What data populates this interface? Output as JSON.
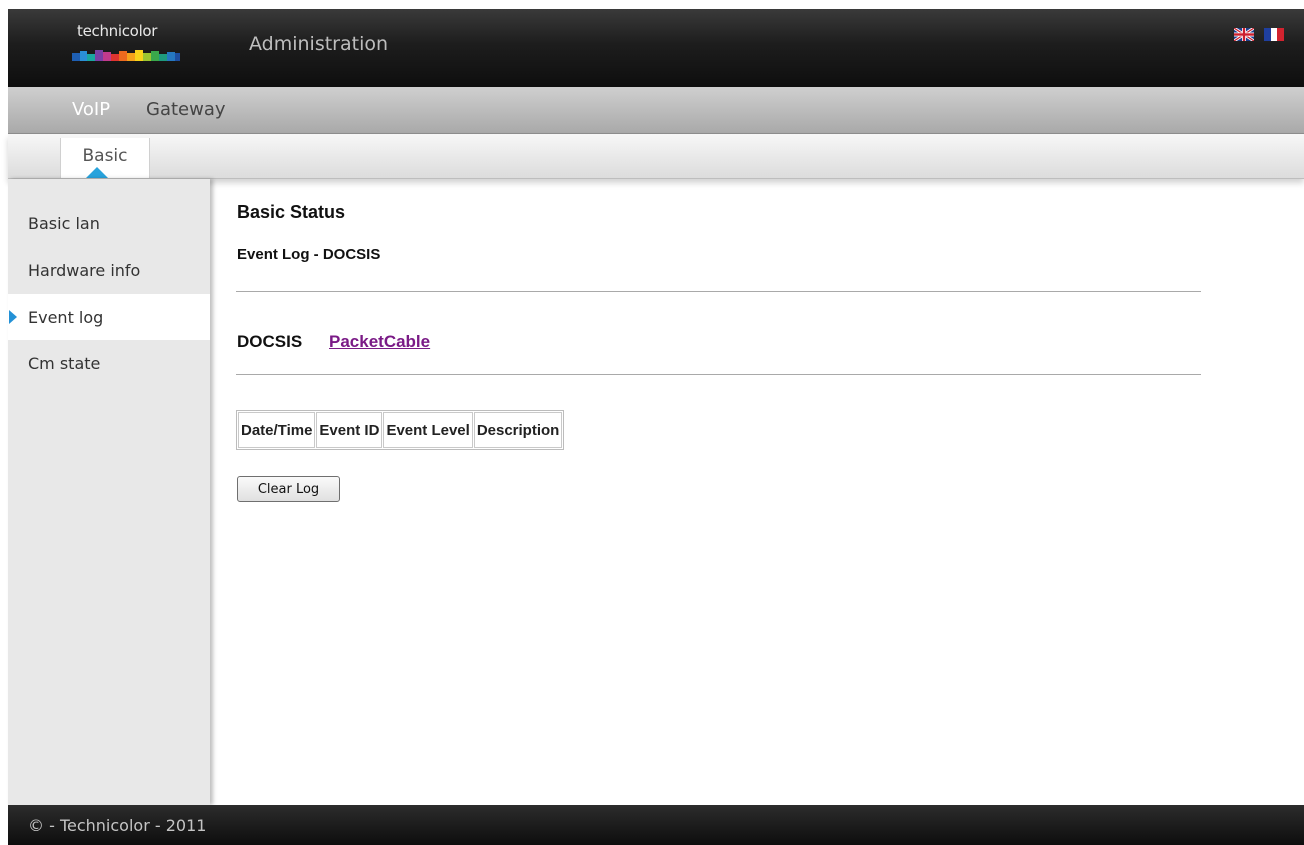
{
  "header": {
    "logo_text": "technicolor",
    "title": "Administration",
    "flags": [
      "uk-flag-icon",
      "fr-flag-icon"
    ]
  },
  "nav_primary": {
    "items": [
      {
        "label": "VoIP",
        "active": true
      },
      {
        "label": "Gateway",
        "active": false
      }
    ]
  },
  "nav_secondary": {
    "tabs": [
      {
        "label": "Basic",
        "active": true
      }
    ]
  },
  "sidebar": {
    "items": [
      {
        "label": "Basic lan",
        "active": false
      },
      {
        "label": "Hardware info",
        "active": false
      },
      {
        "label": "Event log",
        "active": true
      },
      {
        "label": "Cm state",
        "active": false
      }
    ]
  },
  "main": {
    "heading": "Basic Status",
    "subheading": "Event Log - DOCSIS",
    "log_tabs": {
      "current": "DOCSIS",
      "link": "PacketCable"
    },
    "table": {
      "columns": [
        "Date/Time",
        "Event ID",
        "Event Level",
        "Description"
      ],
      "rows": []
    },
    "clear_button": "Clear Log"
  },
  "footer": {
    "text": "© - Technicolor - 2011"
  },
  "colors": {
    "accent": "#29a3dc",
    "link_visited": "#7a1a86"
  }
}
